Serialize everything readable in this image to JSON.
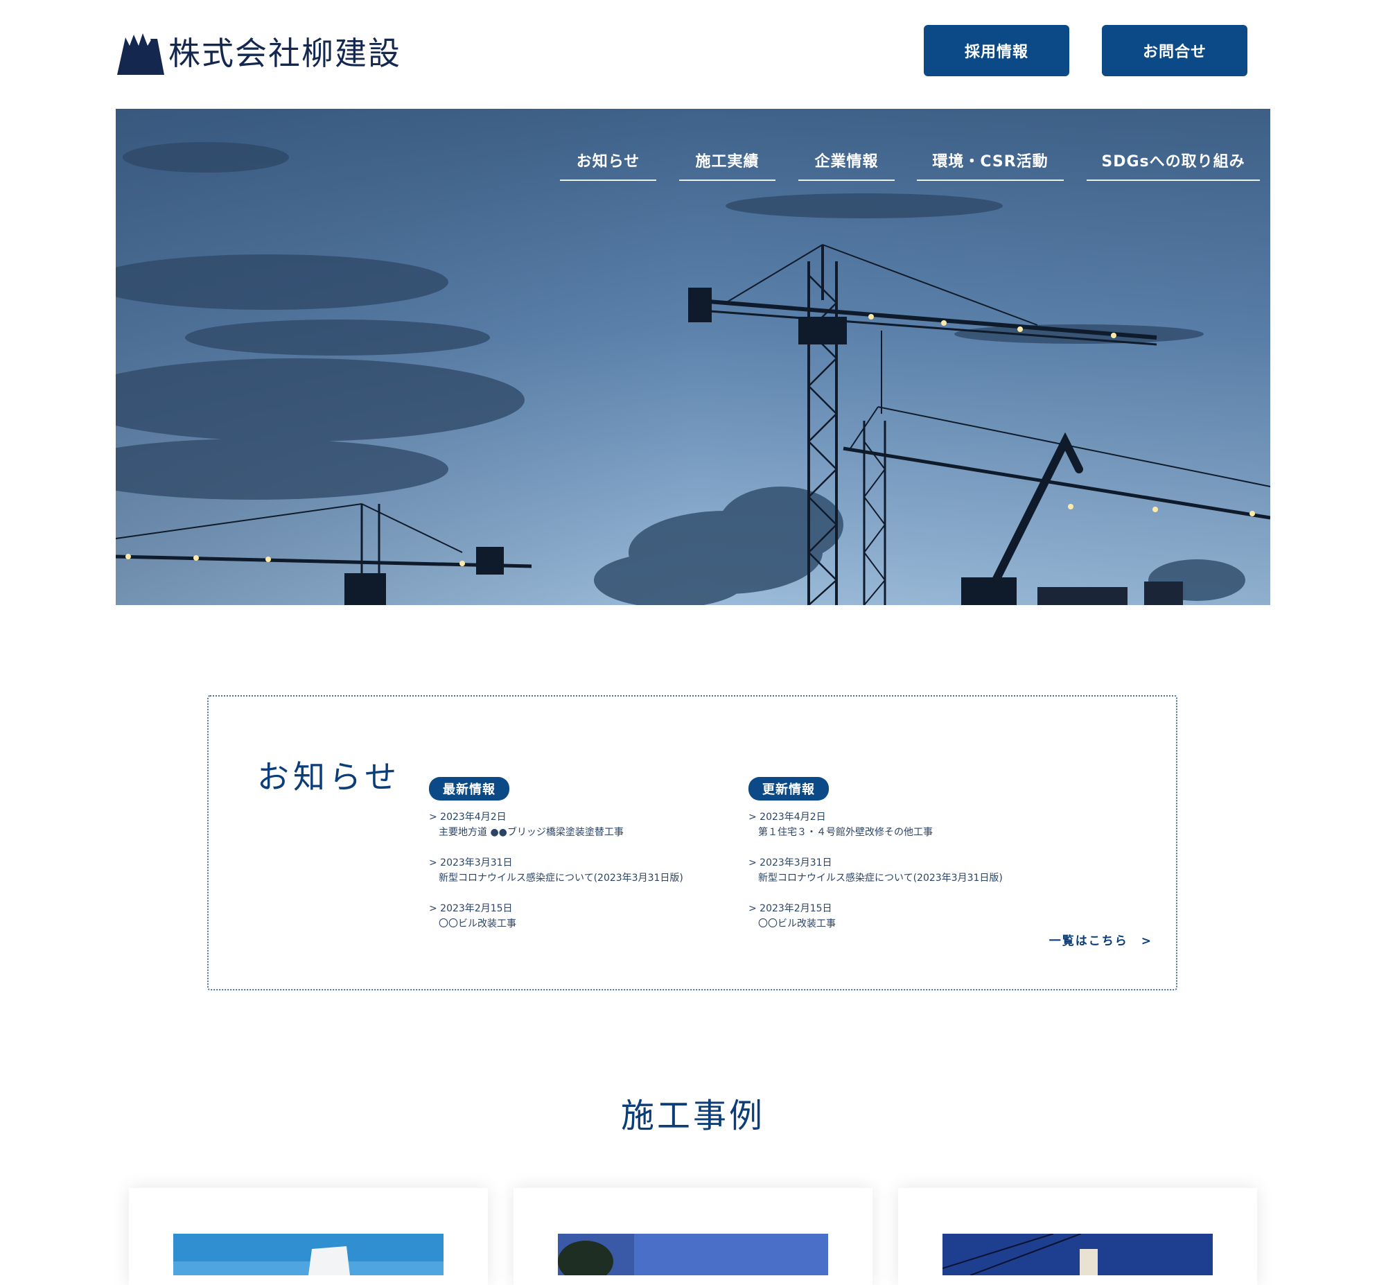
{
  "header": {
    "company_name": "株式会社柳建設",
    "buttons": {
      "recruit": "採用情報",
      "contact": "お問合せ"
    }
  },
  "nav": {
    "items": [
      {
        "label": "お知らせ"
      },
      {
        "label": "施工実績"
      },
      {
        "label": "企業情報"
      },
      {
        "label": "環境・CSR活動"
      },
      {
        "label": "SDGsへの取り組み"
      }
    ]
  },
  "news": {
    "title": "お知らせ",
    "latest": {
      "label": "最新情報",
      "items": [
        {
          "date": "> 2023年4月2日",
          "text": "主要地方道 ●●ブリッジ橋梁塗装塗替工事"
        },
        {
          "date": "> 2023年3月31日",
          "text": "新型コロナウイルス感染症について(2023年3月31日版)"
        },
        {
          "date": "> 2023年2月15日",
          "text": "〇〇ビル改装工事"
        }
      ]
    },
    "updates": {
      "label": "更新情報",
      "items": [
        {
          "date": "> 2023年4月2日",
          "text": "第１住宅３・４号館外壁改修その他工事"
        },
        {
          "date": "> 2023年3月31日",
          "text": "新型コロナウイルス感染症について(2023年3月31日版)"
        },
        {
          "date": "> 2023年2月15日",
          "text": "〇〇ビル改装工事"
        }
      ]
    },
    "more_link": "一覧はこちら　>"
  },
  "works": {
    "title": "施工事例"
  },
  "colors": {
    "brand": "#0b4a86",
    "heading": "#0b3d78",
    "sky_top": "#4d6f97",
    "sky_bottom": "#8fb3d6"
  },
  "icons": {
    "logo": "mountain-logo-icon"
  }
}
